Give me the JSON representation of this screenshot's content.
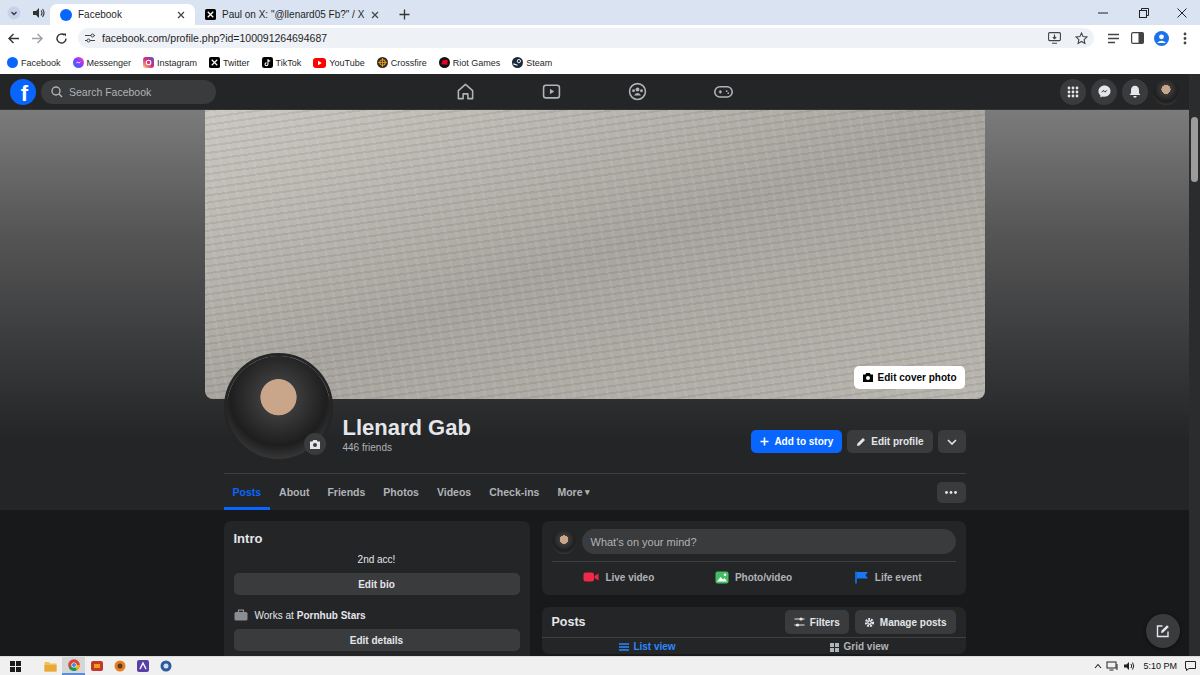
{
  "browser": {
    "tabs": [
      {
        "label": "Facebook",
        "selected": true
      },
      {
        "label": "Paul on X: \"@llenard05 Fb?\" / X",
        "selected": false
      }
    ],
    "url": "facebook.com/profile.php?id=100091264694687",
    "bookmarks": [
      "Facebook",
      "Messenger",
      "Instagram",
      "Twitter",
      "TikTok",
      "YouTube",
      "Crossfire",
      "Riot Games",
      "Steam"
    ]
  },
  "facebook": {
    "logo": "f",
    "search": {
      "placeholder": "Search Facebook"
    },
    "cover_button": "Edit cover photo",
    "profile": {
      "name": "Llenard Gab",
      "friends": "446 friends"
    },
    "actions": {
      "add_story": "Add to story",
      "edit_profile": "Edit profile"
    },
    "tabs": [
      {
        "label": "Posts",
        "selected": true
      },
      {
        "label": "About",
        "selected": false
      },
      {
        "label": "Friends",
        "selected": false
      },
      {
        "label": "Photos",
        "selected": false
      },
      {
        "label": "Videos",
        "selected": false
      },
      {
        "label": "Check-ins",
        "selected": false
      },
      {
        "label": "More",
        "selected": false,
        "caret": "▾"
      }
    ],
    "intro": {
      "title": "Intro",
      "bio": "2nd acc!",
      "edit_bio": "Edit bio",
      "work_prefix": "Works at",
      "workplace": "Pornhub Stars",
      "edit_details": "Edit details"
    },
    "composer": {
      "placeholder": "What's on your mind?",
      "actions": [
        {
          "label": "Live video",
          "color": "#f02849"
        },
        {
          "label": "Photo/video",
          "color": "#45bd62"
        },
        {
          "label": "Life event",
          "color": "#1877f2"
        }
      ]
    },
    "posts": {
      "title": "Posts",
      "buttons": [
        "Filters",
        "Manage posts"
      ],
      "views": [
        {
          "label": "List view",
          "selected": true
        },
        {
          "label": "Grid view",
          "selected": false
        }
      ]
    }
  },
  "taskbar": {
    "time": "5:10 PM"
  }
}
